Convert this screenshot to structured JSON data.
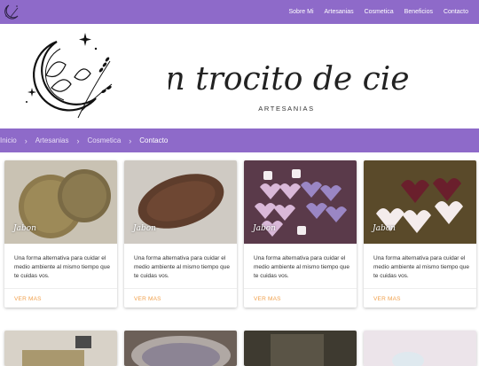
{
  "nav": {
    "links": [
      "Sobre Mi",
      "Artesanias",
      "Cosmetica",
      "Beneficios",
      "Contacto"
    ]
  },
  "banner": {
    "title": "Un trocito de cielo",
    "subtitle": "ARTESANIAS"
  },
  "breadcrumb": {
    "items": [
      "Inicio",
      "Artesanias",
      "Cosmetica",
      "Contacto"
    ]
  },
  "cards": [
    {
      "label": "Jabon",
      "text": "Una forma alternativa para cuidar el medio ambiente al mismo tiempo que te cuidas vos.",
      "link": "VER MAS"
    },
    {
      "label": "Jabon",
      "text": "Una forma alternativa para cuidar el medio ambiente al mismo tiempo que te cuidas vos.",
      "link": "VER MAS"
    },
    {
      "label": "Jabon",
      "text": "Una forma alternativa para cuidar el medio ambiente al mismo tiempo que te cuidas vos.",
      "link": "VER MAS"
    },
    {
      "label": "Jabon",
      "text": "Una forma alternativa para cuidar el medio ambiente al mismo tiempo que te cuidas vos.",
      "link": "VER MAS"
    }
  ],
  "colors": {
    "nav": "#8e6ac9",
    "link": "#f0a14d"
  }
}
